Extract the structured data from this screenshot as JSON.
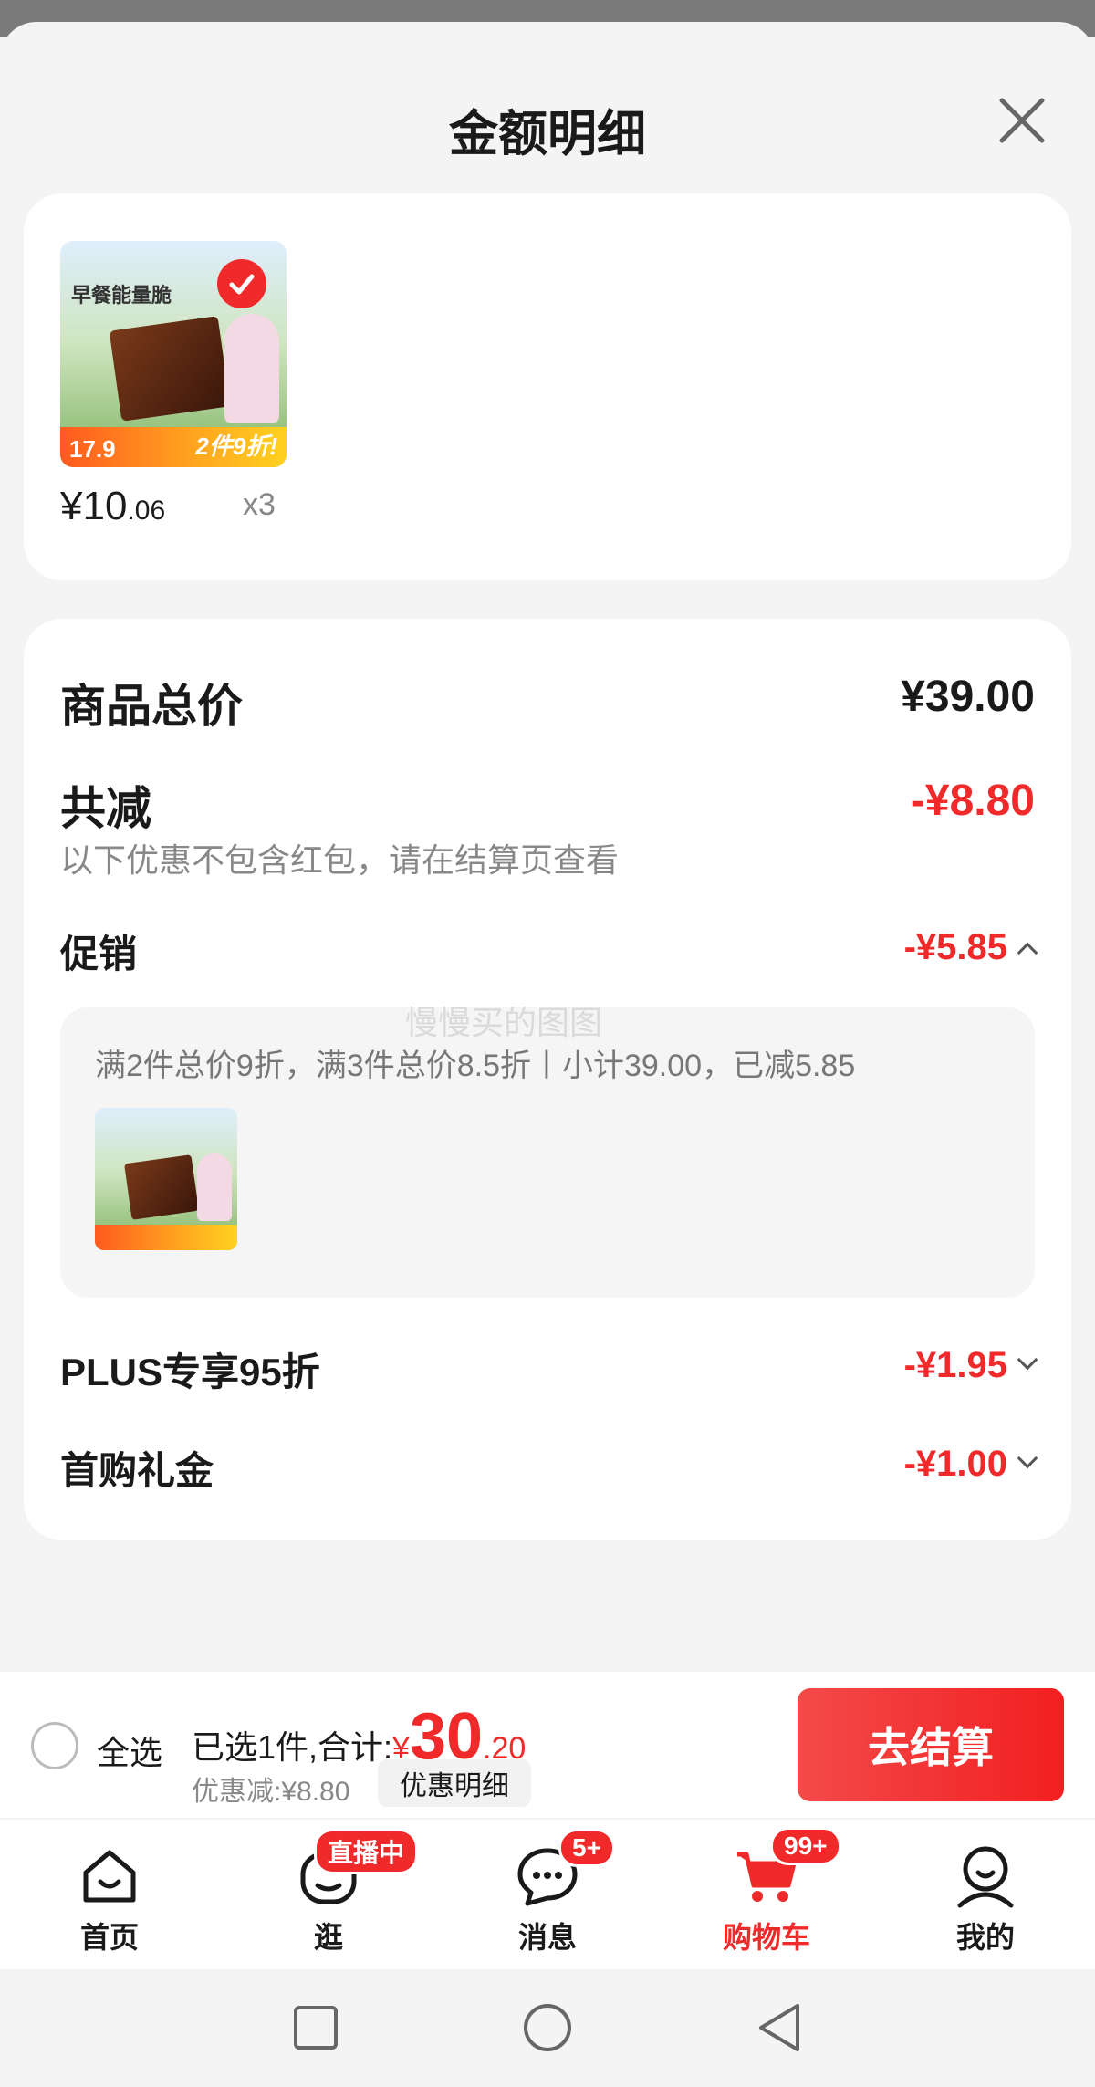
{
  "sheet": {
    "title": "金额明细"
  },
  "product": {
    "price_int": "¥10",
    "price_dec": ".06",
    "qty": "x3",
    "thumb_head": "早餐能量脆",
    "thumb_price": "17.9",
    "thumb_promo": "2件9折!"
  },
  "summary": {
    "total_label": "商品总价",
    "total_value": "¥39.00",
    "reduce_label": "共减",
    "reduce_value": "-¥8.80",
    "reduce_note": "以下优惠不包含红包，请在结算页查看",
    "promo_label": "促销",
    "promo_value": "-¥5.85",
    "promo_detail": "满2件总价9折，满3件总价8.5折丨小计39.00，已减5.85",
    "plus_label": "PLUS专享95折",
    "plus_value": "-¥1.95",
    "first_label": "首购礼金",
    "first_value": "-¥1.00",
    "watermark": "慢慢买的图图"
  },
  "checkout": {
    "select_all": "全选",
    "selected_text": "已选1件,合计:",
    "yen": "¥",
    "total_int": "30",
    "total_dec": ".20",
    "discount_text": "优惠减:¥8.80",
    "detail_btn": "优惠明细",
    "go_btn": "去结算"
  },
  "tabs": [
    {
      "label": "首页",
      "icon": "home-icon"
    },
    {
      "label": "逛",
      "icon": "browse-icon",
      "badge": "直播中"
    },
    {
      "label": "消息",
      "icon": "message-icon",
      "badge": "5+"
    },
    {
      "label": "购物车",
      "icon": "cart-icon",
      "badge": "99+"
    },
    {
      "label": "我的",
      "icon": "profile-icon"
    }
  ],
  "colors": {
    "accent": "#f02a2a",
    "muted": "#888888"
  }
}
